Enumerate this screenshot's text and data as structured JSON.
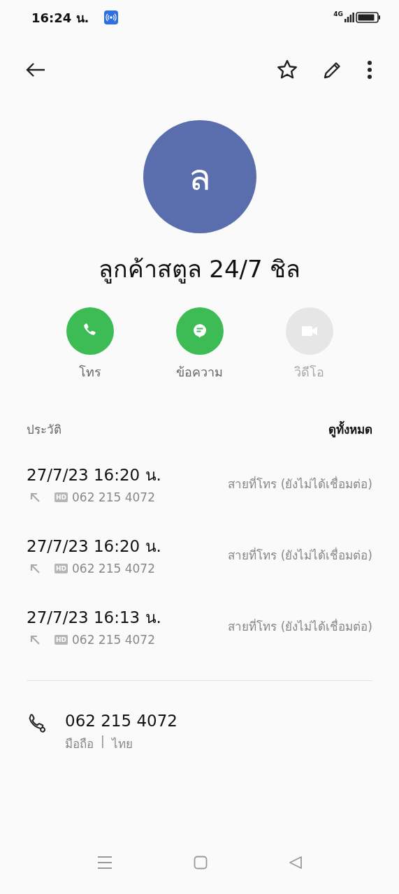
{
  "status_bar": {
    "time": "16:24 น.",
    "network": "4G"
  },
  "avatar": {
    "initial": "ล"
  },
  "contact_name": "ลูกค้าสตูล 24/7 ชิล",
  "actions": [
    {
      "kind": "call",
      "label": "โทร",
      "disabled": false
    },
    {
      "kind": "message",
      "label": "ข้อความ",
      "disabled": false
    },
    {
      "kind": "video",
      "label": "วิดีโอ",
      "disabled": true
    }
  ],
  "history": {
    "title": "ประวัติ",
    "view_all": "ดูทั้งหมด",
    "entries": [
      {
        "datetime": "27/7/23 16:20 น.",
        "badge": "HD",
        "number": "062 215 4072",
        "status": "สายที่โทร (ยังไม่ได้เชื่อมต่อ)"
      },
      {
        "datetime": "27/7/23 16:20 น.",
        "badge": "HD",
        "number": "062 215 4072",
        "status": "สายที่โทร (ยังไม่ได้เชื่อมต่อ)"
      },
      {
        "datetime": "27/7/23 16:13 น.",
        "badge": "HD",
        "number": "062 215 4072",
        "status": "สายที่โทร (ยังไม่ได้เชื่อมต่อ)"
      }
    ]
  },
  "phone": {
    "number": "062 215 4072",
    "type": "มือถือ",
    "separator": "|",
    "region": "ไทย"
  }
}
